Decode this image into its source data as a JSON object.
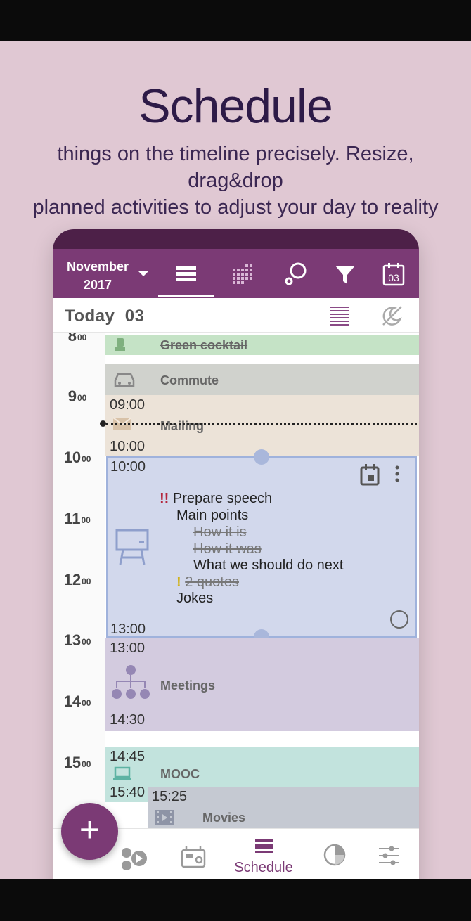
{
  "promo": {
    "title": "Schedule",
    "subtitle_line1": "things on the timeline precisely. Resize, drag&drop",
    "subtitle_line2": "planned activities to adjust your day to reality"
  },
  "toolbar": {
    "month": "November",
    "year": "2017",
    "calendar_day": "03",
    "icons": [
      "dropdown-arrow-icon",
      "list-view-icon",
      "grid-view-icon",
      "search-icon",
      "filter-icon",
      "calendar-icon"
    ]
  },
  "subbar": {
    "today_label": "Today",
    "day": "03"
  },
  "hours": [
    {
      "h": "8",
      "m": "00"
    },
    {
      "h": "9",
      "m": "00"
    },
    {
      "h": "10",
      "m": "00"
    },
    {
      "h": "11",
      "m": "00"
    },
    {
      "h": "12",
      "m": "00"
    },
    {
      "h": "13",
      "m": "00"
    },
    {
      "h": "14",
      "m": "00"
    },
    {
      "h": "15",
      "m": "00"
    }
  ],
  "events": {
    "green_cocktail": {
      "title": "Green cocktail",
      "color": "#c5e3c6"
    },
    "commute": {
      "title": "Commute",
      "color": "#d0d2cd"
    },
    "mailing": {
      "title": "Mailing",
      "start": "09:00",
      "end": "10:00",
      "color": "#ece3d8"
    },
    "prepare_speech": {
      "start": "10:00",
      "end": "13:00",
      "color": "#d2d8ec",
      "priority": "!!",
      "title": "Prepare speech",
      "items": [
        {
          "text": "Main points",
          "done": false
        },
        {
          "text": "How it is",
          "done": true
        },
        {
          "text": "How it was",
          "done": true
        },
        {
          "text": "What we should do next",
          "done": false
        },
        {
          "text": "2 quotes",
          "done": true,
          "mark": "!"
        },
        {
          "text": "Jokes",
          "done": false
        }
      ]
    },
    "meetings": {
      "title": "Meetings",
      "start": "13:00",
      "end": "14:30",
      "color": "#d3cbdf"
    },
    "mooc": {
      "title": "MOOC",
      "start": "14:45",
      "end": "15:40",
      "color": "#c2e3dd"
    },
    "movies": {
      "title": "Movies",
      "start": "15:25",
      "color": "#c5c9d2"
    }
  },
  "bottom_nav": {
    "active_label": "Schedule",
    "items": [
      "activities-icon",
      "radio-icon",
      "schedule-icon",
      "statistics-icon",
      "settings-icon"
    ]
  },
  "fab_symbol": "+",
  "colors": {
    "brand": "#7b3a75",
    "brand_dark": "#4d2048",
    "promo_bg": "#e0c8d3",
    "headline": "#2d1a47",
    "handle": "#a9b7db",
    "priority_red": "#b3243b",
    "priority_yellow": "#d0b21c"
  }
}
